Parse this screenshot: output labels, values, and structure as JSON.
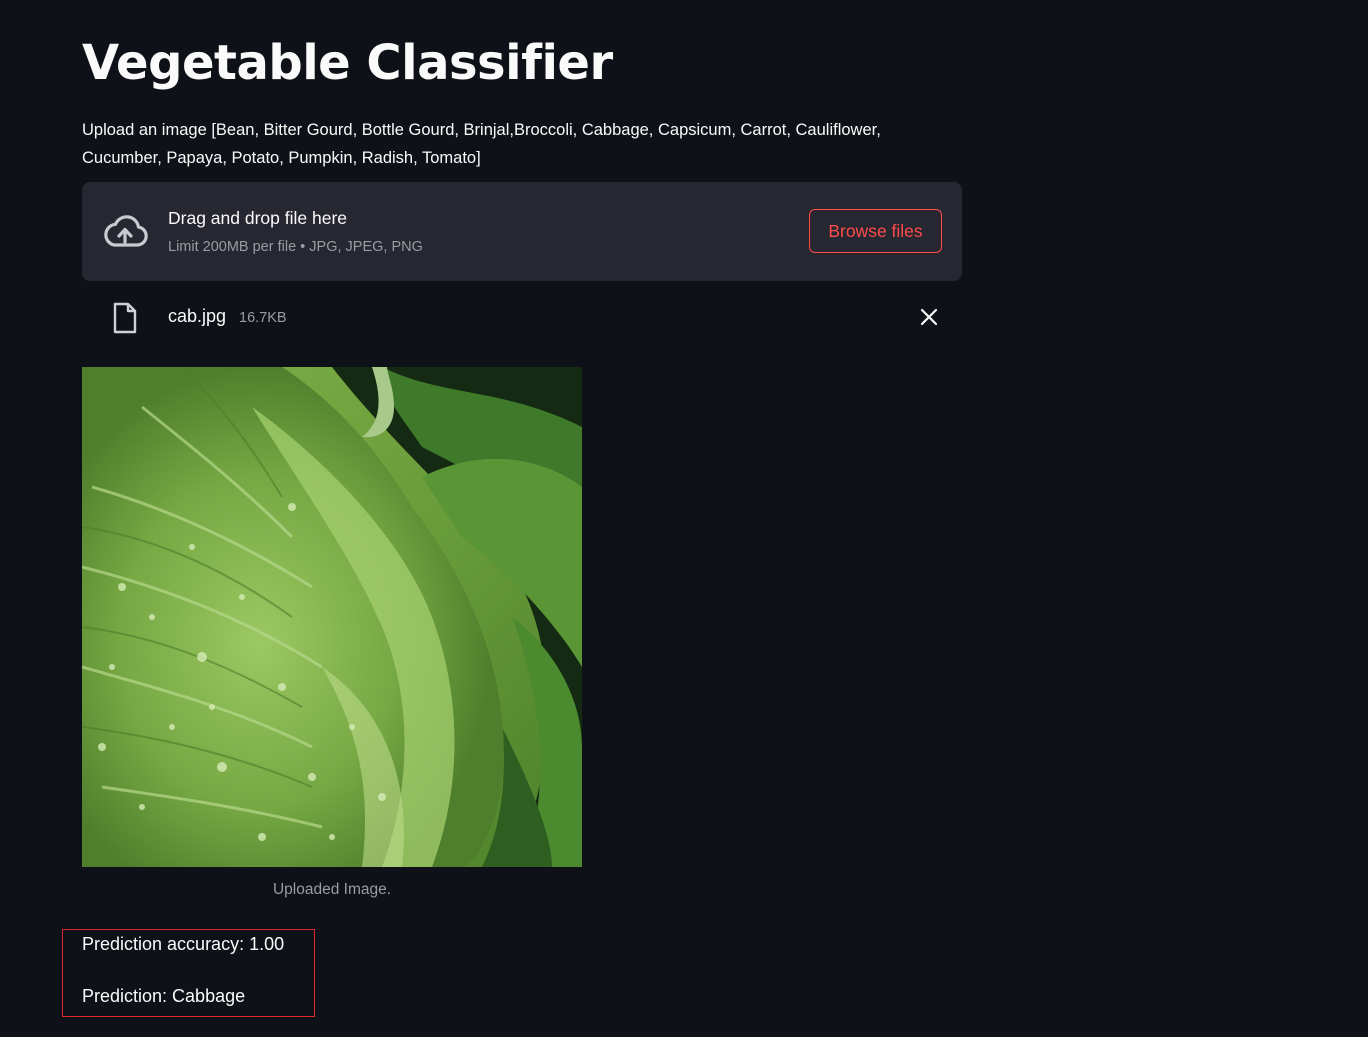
{
  "app": {
    "title": "Vegetable Classifier",
    "instructions": "Upload an image [Bean, Bitter Gourd, Bottle Gourd, Brinjal,Broccoli, Cabbage, Capsicum, Carrot, Cauliflower, Cucumber, Papaya, Potato, Pumpkin, Radish, Tomato]"
  },
  "uploader": {
    "drag_text": "Drag and drop file here",
    "limit_text": "Limit 200MB per file • JPG, JPEG, PNG",
    "browse_label": "Browse files",
    "upload_icon": "cloud-upload-icon"
  },
  "file": {
    "name": "cab.jpg",
    "size": "16.7KB",
    "file_icon": "file-icon",
    "remove_icon": "close-icon"
  },
  "image": {
    "caption": "Uploaded Image."
  },
  "result": {
    "accuracy_text": "Prediction accuracy: 1.00",
    "prediction_text": "Prediction: Cabbage"
  },
  "colors": {
    "background": "#0e1117",
    "dropzone_bg": "#262730",
    "accent": "#ff4b4b",
    "highlight_border": "#e0262b"
  }
}
